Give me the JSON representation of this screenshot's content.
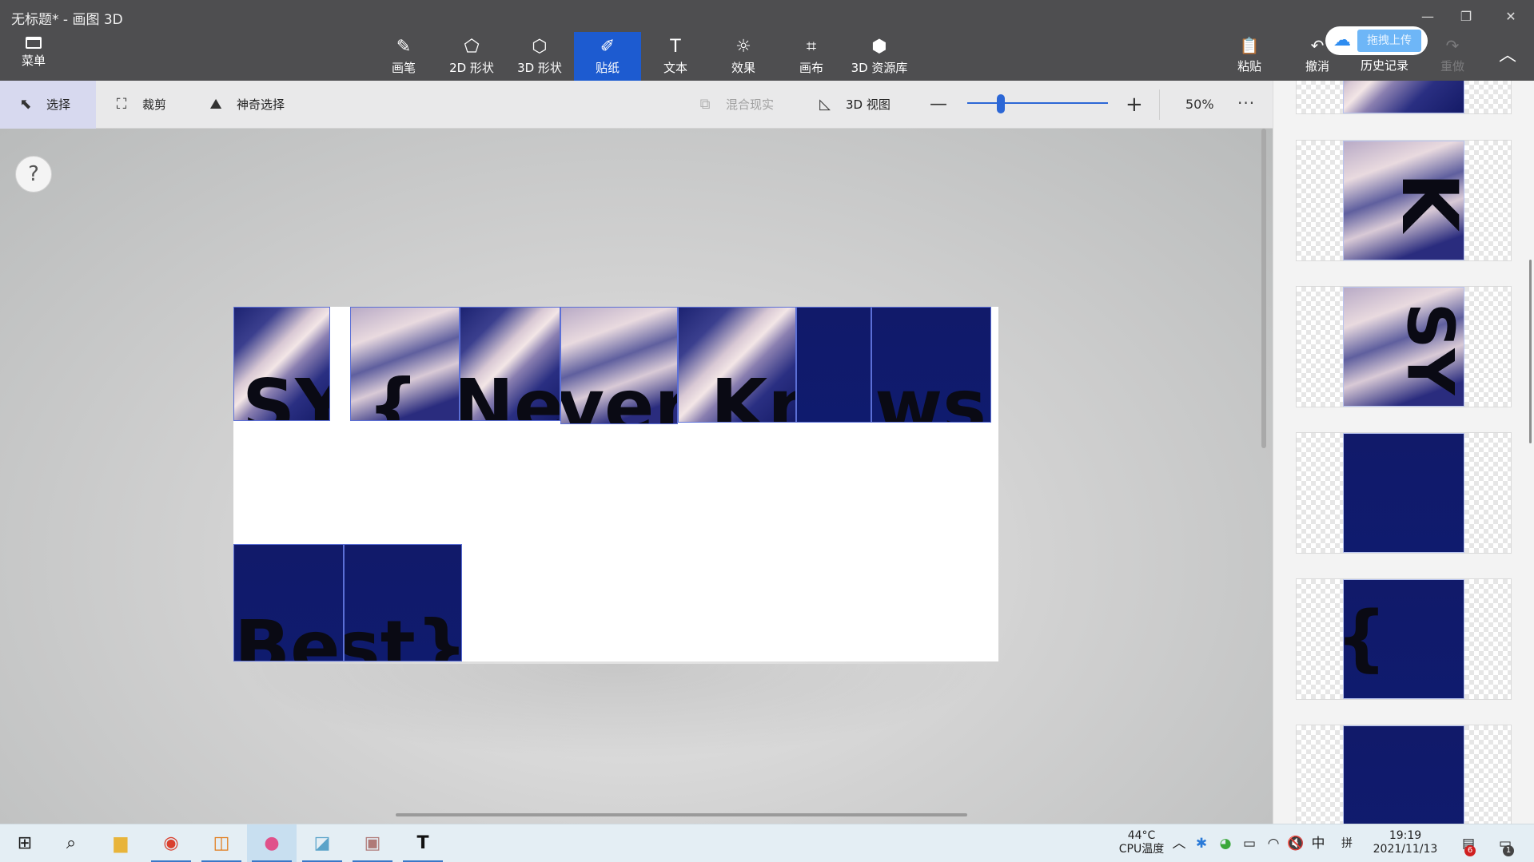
{
  "window": {
    "title": "无标题* - 画图 3D",
    "minimize_glyph": "—",
    "restore_glyph": "❐",
    "close_glyph": "✕"
  },
  "ribbon": {
    "menu_label": "菜单",
    "tools": [
      {
        "label": "画笔",
        "icon": "brush-icon",
        "glyph": "✎"
      },
      {
        "label": "2D 形状",
        "icon": "shapes-2d-icon",
        "glyph": "⬠"
      },
      {
        "label": "3D 形状",
        "icon": "cube-icon",
        "glyph": "⬡"
      },
      {
        "label": "贴纸",
        "icon": "sticker-icon",
        "glyph": "✐"
      },
      {
        "label": "文本",
        "icon": "text-icon",
        "glyph": "T"
      },
      {
        "label": "效果",
        "icon": "effects-icon",
        "glyph": "☼"
      },
      {
        "label": "画布",
        "icon": "canvas-icon",
        "glyph": "⌗"
      },
      {
        "label": "3D 资源库",
        "icon": "library-icon",
        "glyph": "⬢"
      }
    ],
    "active_tool": "贴纸",
    "paste_label": "粘贴",
    "undo_label": "撤消",
    "history_label": "历史记录",
    "redo_label": "重做",
    "upload_label": "拖拽上传"
  },
  "toolbar": {
    "select_label": "选择",
    "crop_label": "裁剪",
    "magic_select_label": "神奇选择",
    "mixed_reality_label": "混合现实",
    "view_3d_label": "3D 视图",
    "zoom_percent": "50%",
    "zoom_level": 0.24,
    "more_glyph": "···"
  },
  "workspace": {
    "help_glyph": "?"
  },
  "canvas": {
    "row1_text": [
      "SYC",
      "{",
      "Ne",
      "ver ",
      "Kn",
      "ows"
    ],
    "row2_text": [
      "Be",
      "st}"
    ]
  },
  "stickers": {
    "glyphs": [
      "",
      "K",
      "SY",
      "",
      "{",
      ""
    ]
  },
  "taskbar": {
    "apps": [
      {
        "name": "start-icon",
        "glyph": "⊞"
      },
      {
        "name": "search-icon",
        "glyph": "⌕"
      },
      {
        "name": "file-explorer-icon",
        "glyph": "▆"
      },
      {
        "name": "chrome-icon",
        "glyph": "◉"
      },
      {
        "name": "app-orange-icon",
        "glyph": "◫"
      },
      {
        "name": "paint3d-icon",
        "glyph": "●"
      },
      {
        "name": "notepad-icon",
        "glyph": "◪"
      },
      {
        "name": "photo-icon",
        "glyph": "▣"
      },
      {
        "name": "typora-icon",
        "glyph": "T"
      }
    ],
    "cpu_temp": "44°C",
    "cpu_label": "CPU温度",
    "tray_up_glyph": "︿",
    "ime_lang": "中",
    "ime_mode": "拼",
    "time": "19:19",
    "date": "2021/11/13",
    "notif_count_app": "6",
    "notif_count_center": "1"
  },
  "colors": {
    "accent": "#1d5bd0",
    "titlebar": "#4e4e50",
    "tile_navy": "#111a6a"
  }
}
